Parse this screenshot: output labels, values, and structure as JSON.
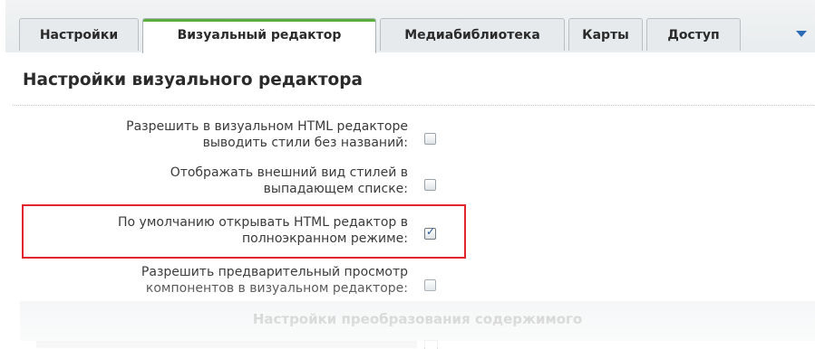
{
  "tabs": [
    {
      "label": "Настройки",
      "active": false
    },
    {
      "label": "Визуальный редактор",
      "active": true
    },
    {
      "label": "Медиабиблиотека",
      "active": false
    },
    {
      "label": "Карты",
      "active": false
    },
    {
      "label": "Доступ",
      "active": false
    }
  ],
  "section_title": "Настройки визуального редактора",
  "options": [
    {
      "line1": "Разрешить в визуальном HTML редакторе",
      "line2": "выводить стили без названий:",
      "checked": false
    },
    {
      "line1": "Отображать внешний вид стилей в",
      "line2": "выпадающем списке:",
      "checked": false
    },
    {
      "line1": "По умолчанию открывать HTML редактор в",
      "line2": "полноэкранном режиме:",
      "checked": true
    },
    {
      "line1": "Разрешить предварительный просмотр",
      "line2": "компонентов в визуальном редакторе:",
      "checked": false
    }
  ],
  "subsection_title": "Настройки преобразования содержимого",
  "colors": {
    "active_tab_accent": "#5cae3d",
    "highlight_border": "#e0262b",
    "more_arrow": "#2b6cb6"
  },
  "icons": {
    "more_tabs": "triangle-down-icon",
    "check": "checkmark-icon"
  }
}
